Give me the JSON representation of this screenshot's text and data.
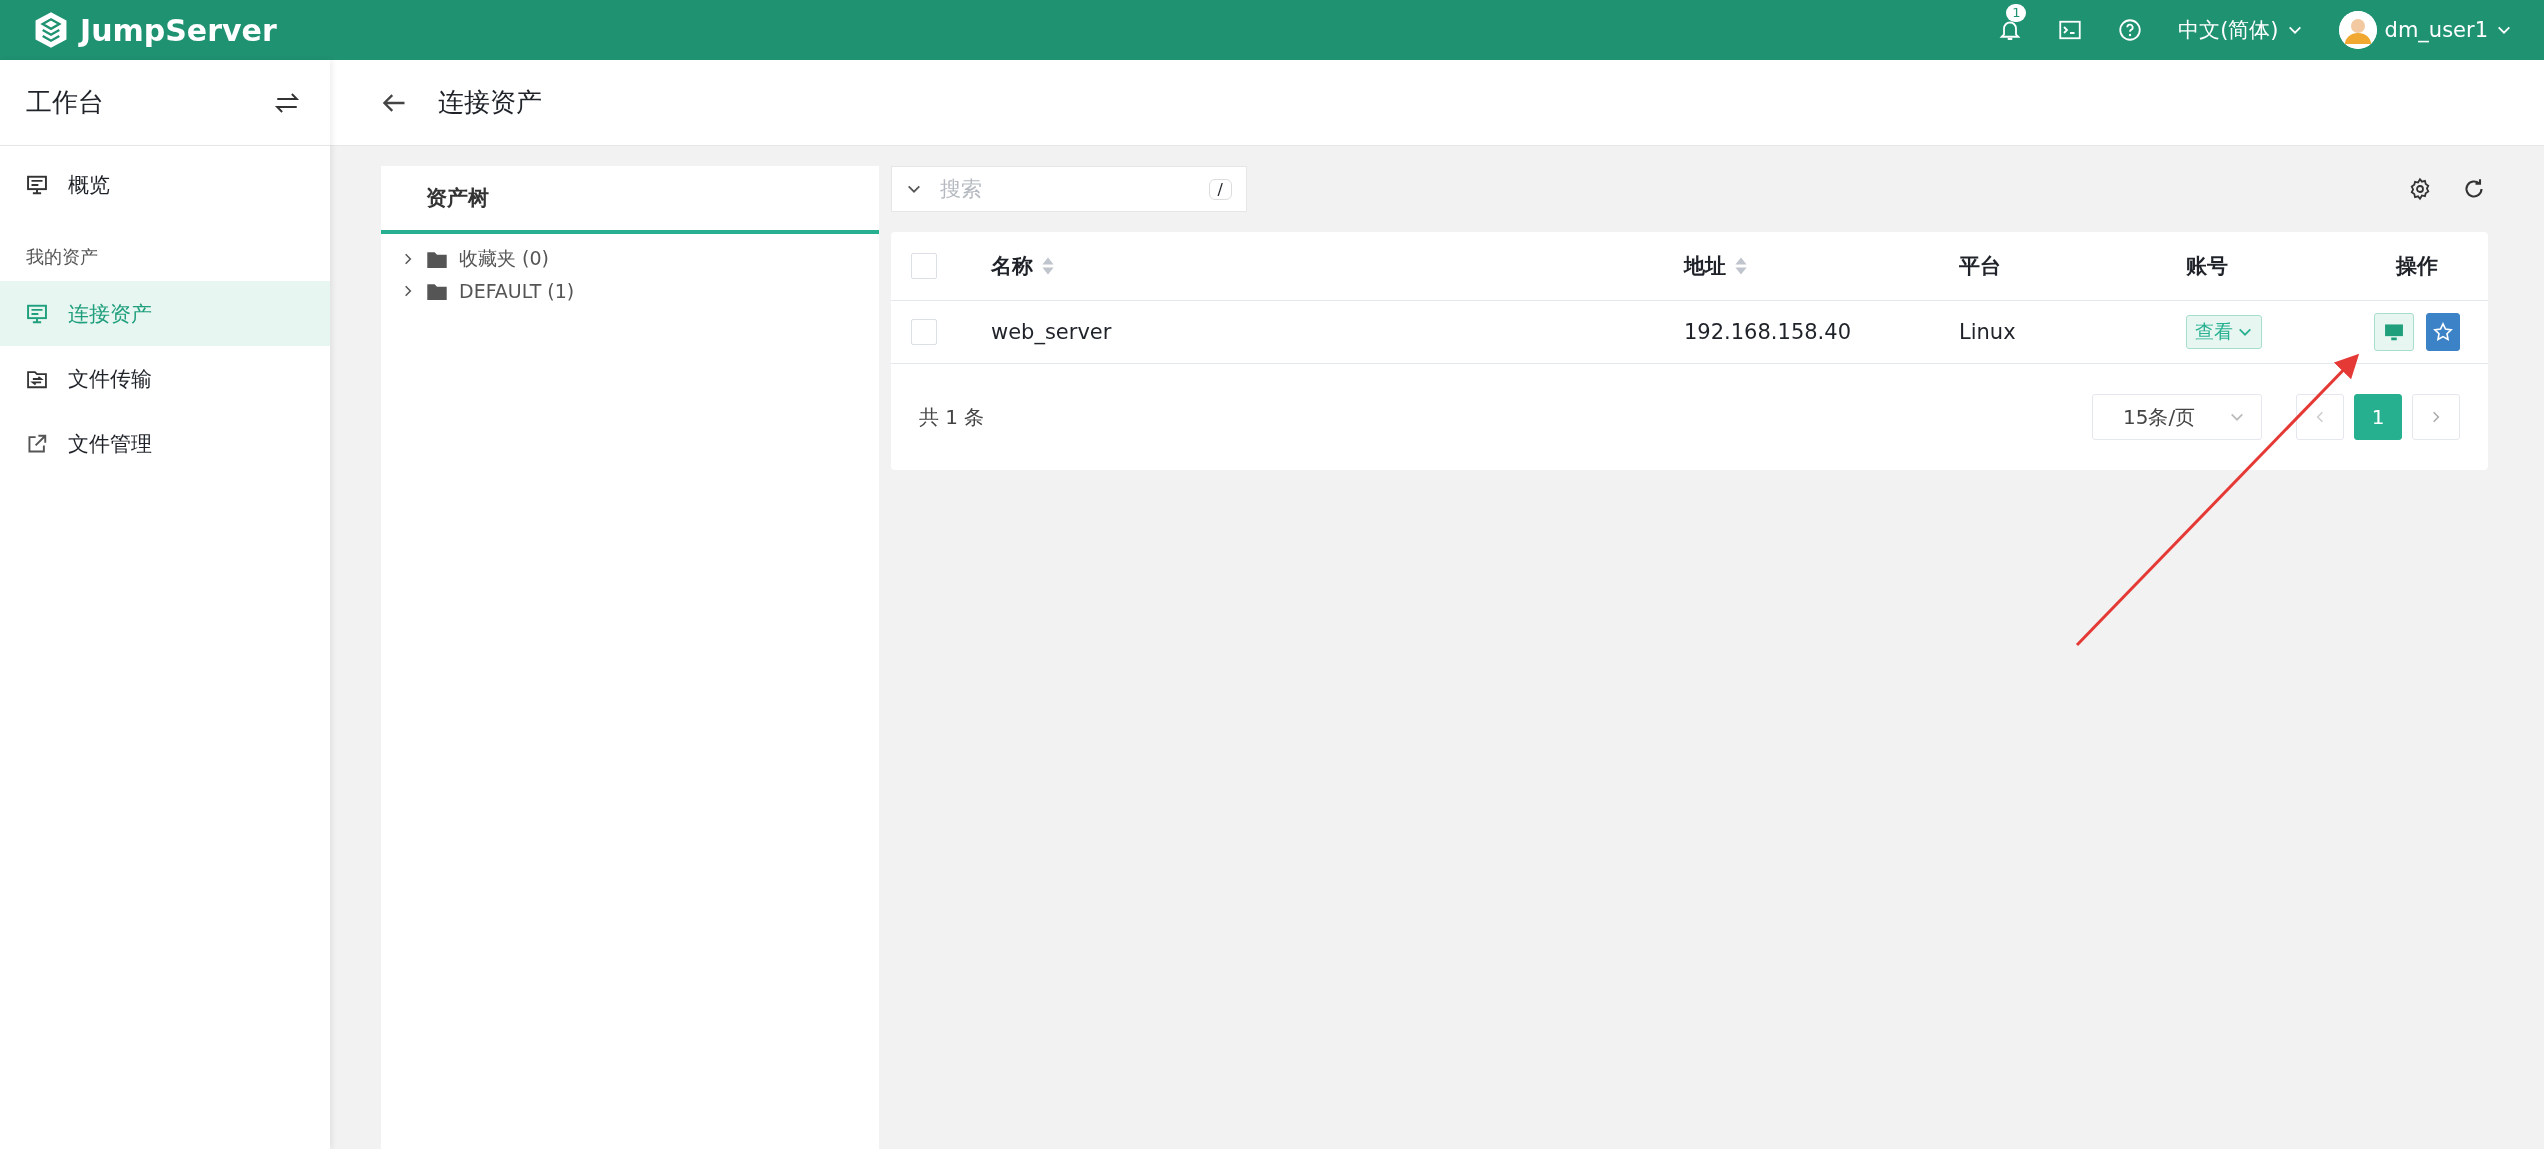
{
  "header": {
    "logo": "JumpServer",
    "notification_count": "1",
    "language": "中文(简体)",
    "username": "dm_user1"
  },
  "sidebar": {
    "title": "工作台",
    "items": [
      {
        "kind": "item",
        "label": "概览",
        "selected": false
      },
      {
        "kind": "group",
        "label": "我的资产"
      },
      {
        "kind": "item",
        "label": "连接资产",
        "selected": true
      },
      {
        "kind": "item",
        "label": "文件传输",
        "selected": false
      },
      {
        "kind": "item",
        "label": "文件管理",
        "selected": false
      }
    ]
  },
  "page": {
    "title": "连接资产"
  },
  "tree": {
    "tab": "资产树",
    "nodes": [
      {
        "label": "收藏夹 (0)",
        "expanded": false
      },
      {
        "label": "DEFAULT (1)",
        "expanded": false
      }
    ]
  },
  "search": {
    "placeholder": "搜索",
    "shortcut": "/"
  },
  "table": {
    "select_all_checked": false,
    "columns": [
      {
        "label": "名称",
        "sortable": true
      },
      {
        "label": "地址",
        "sortable": true
      },
      {
        "label": "平台",
        "sortable": false
      },
      {
        "label": "账号",
        "sortable": false
      },
      {
        "label": "操作",
        "sortable": false
      }
    ],
    "rows": [
      {
        "checked": false,
        "name": "web_server",
        "address": "192.168.158.40",
        "platform": "Linux",
        "account": "查看"
      }
    ]
  },
  "pagination": {
    "total": "共 1 条",
    "page_size": "15条/页",
    "pages": [
      {
        "label": "1",
        "selected": true
      }
    ]
  }
}
